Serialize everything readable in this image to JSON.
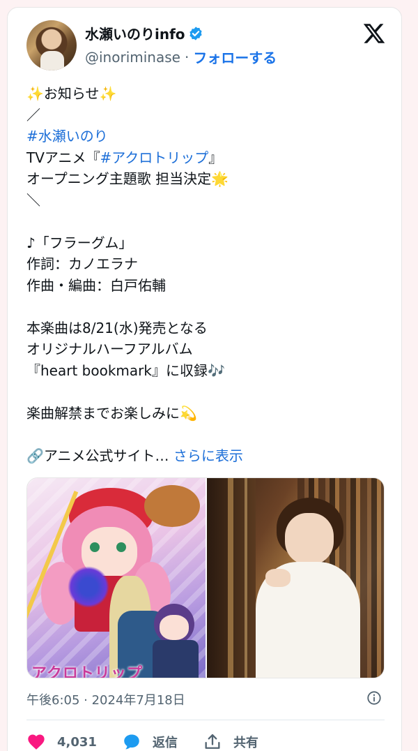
{
  "author": {
    "display_name": "水瀬いのりinfo",
    "handle": "@inoriminase",
    "separator": "·",
    "follow_label": "フォローする"
  },
  "tweet": {
    "lines": [
      {
        "pre": "",
        "text": "お知らせ",
        "post": ""
      },
      {
        "text": "／"
      },
      {
        "link": "#水瀬いのり"
      },
      {
        "pre": "TVアニメ『",
        "link": "#アクロトリップ",
        "post": "』"
      },
      {
        "text": "オープニング主題歌 担当決定"
      },
      {
        "text": "＼"
      },
      {
        "text": ""
      },
      {
        "text": "♪「フラーグム」"
      },
      {
        "text": "作詞：カノエラナ"
      },
      {
        "text": "作曲・編曲：白戸佑輔"
      },
      {
        "text": ""
      },
      {
        "text": "本楽曲は8/21(水)発売となる"
      },
      {
        "text": "オリジナルハーフアルバム"
      },
      {
        "text": "『heart bookmark』に収録"
      },
      {
        "text": ""
      },
      {
        "text": "楽曲解禁までお楽しみに"
      },
      {
        "text": ""
      },
      {
        "text": "アニメ公式サイト…",
        "link": "さらに表示"
      }
    ]
  },
  "media": {
    "left_caption": "アクロトリップ"
  },
  "timestamp": "午後6:05 · 2024年7月18日",
  "actions": {
    "like_count": "4,031",
    "reply_label": "返信",
    "share_label": "共有"
  },
  "colors": {
    "link": "#1d6fd8",
    "like": "#f91880",
    "reply": "#1d9bf0",
    "verified": "#1d9bf0"
  }
}
